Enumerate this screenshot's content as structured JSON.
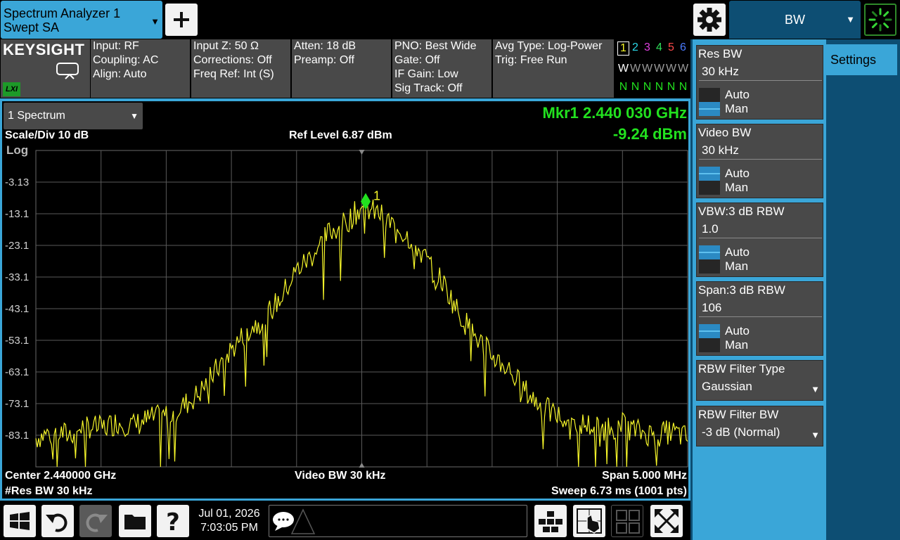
{
  "app": {
    "title_line1": "Spectrum Analyzer 1",
    "title_line2": "Swept SA",
    "menu_label": "BW",
    "brand": "KEYSIGHT",
    "lxi": "LXI"
  },
  "info": {
    "col1": [
      "Input: RF",
      "Coupling: AC",
      "Align: Auto"
    ],
    "col2": [
      "Input Z: 50 Ω",
      "Corrections: Off",
      "Freq Ref: Int (S)"
    ],
    "col3": [
      "Atten: 18 dB",
      "Preamp: Off"
    ],
    "col4": [
      "PNO: Best Wide",
      "Gate: Off",
      "IF Gain: Low",
      "Sig Track: Off"
    ],
    "col5": [
      "Avg Type: Log-Power",
      "Trig: Free Run"
    ],
    "traces": {
      "numbers": [
        "1",
        "2",
        "3",
        "4",
        "5",
        "6"
      ],
      "colors": [
        "#f5f52a",
        "#2ad8e8",
        "#e040e0",
        "#2ee05a",
        "#ff4a4a",
        "#4a7bff"
      ],
      "types": [
        "W",
        "W",
        "W",
        "W",
        "W",
        "W"
      ],
      "detectors": [
        "N",
        "N",
        "N",
        "N",
        "N",
        "N"
      ]
    }
  },
  "window": {
    "select_label": "1 Spectrum",
    "scale_div": "Scale/Div 10 dB",
    "scale_type": "Log",
    "ref_level": "Ref Level 6.87 dBm",
    "marker_freq": "Mkr1  2.440 030 GHz",
    "marker_amp": "-9.24 dBm",
    "center": "Center 2.440000 GHz",
    "res_bw": "#Res BW 30 kHz",
    "video_bw": "Video BW 30 kHz",
    "span": "Span 5.000 MHz",
    "sweep": "Sweep 6.73 ms (1001 pts)",
    "marker_label": "1"
  },
  "chart_data": {
    "type": "line",
    "xlabel": "",
    "ylabel": "",
    "y_tick_labels": [
      "-3.13",
      "-13.1",
      "-23.1",
      "-33.1",
      "-43.1",
      "-53.1",
      "-63.1",
      "-73.1",
      "-83.1"
    ],
    "ylim": [
      -93.13,
      6.87
    ],
    "x_unit": "MHz offset from center",
    "xlim": [
      -2.5,
      2.5
    ],
    "grid": true,
    "trace_color": "#f5f52a",
    "marker": {
      "x": 0.03,
      "y": -9.24,
      "color": "#22e11f"
    },
    "series": [
      {
        "x": [
          -2.5,
          -2.375,
          -2.25,
          -2.125,
          -2.0,
          -1.875,
          -1.75,
          -1.625,
          -1.5,
          -1.375,
          -1.25,
          -1.125,
          -1.0,
          -0.875,
          -0.75,
          -0.625,
          -0.5,
          -0.375,
          -0.25,
          -0.125,
          0.0,
          0.125,
          0.25,
          0.375,
          0.5,
          0.625,
          0.75,
          0.875,
          1.0,
          1.125,
          1.25,
          1.375,
          1.5,
          1.625,
          1.75,
          1.875,
          2.0,
          2.125,
          2.25,
          2.375,
          2.5
        ],
        "values": [
          -84,
          -82,
          -83,
          -80,
          -81,
          -79,
          -80,
          -78,
          -77,
          -74,
          -70,
          -63,
          -56,
          -50,
          -46,
          -40,
          -31,
          -26,
          -19,
          -16,
          -11,
          -13,
          -17,
          -21,
          -28,
          -35,
          -45,
          -52,
          -58,
          -62,
          -69,
          -74,
          -77,
          -79,
          -80,
          -81,
          -80,
          -82,
          -83,
          -82,
          -84
        ]
      }
    ]
  },
  "status": {
    "date": "Jul 01, 2026",
    "time": "7:03:05 PM"
  },
  "softkeys": {
    "settings_tab": "Settings",
    "res_bw": {
      "title": "Res BW",
      "value": "30 kHz",
      "auto": "Auto",
      "man": "Man",
      "selected": "Man"
    },
    "video_bw": {
      "title": "Video BW",
      "value": "30 kHz",
      "auto": "Auto",
      "man": "Man",
      "selected": "Auto"
    },
    "vbw_rbw": {
      "title": "VBW:3 dB RBW",
      "value": "1.0",
      "auto": "Auto",
      "man": "Man",
      "selected": "Auto"
    },
    "span_rbw": {
      "title": "Span:3 dB RBW",
      "value": "106",
      "auto": "Auto",
      "man": "Man",
      "selected": "Auto"
    },
    "filter_type": {
      "title": "RBW Filter Type",
      "value": "Gaussian"
    },
    "filter_bw": {
      "title": "RBW Filter BW",
      "value": "-3 dB (Normal)"
    }
  }
}
